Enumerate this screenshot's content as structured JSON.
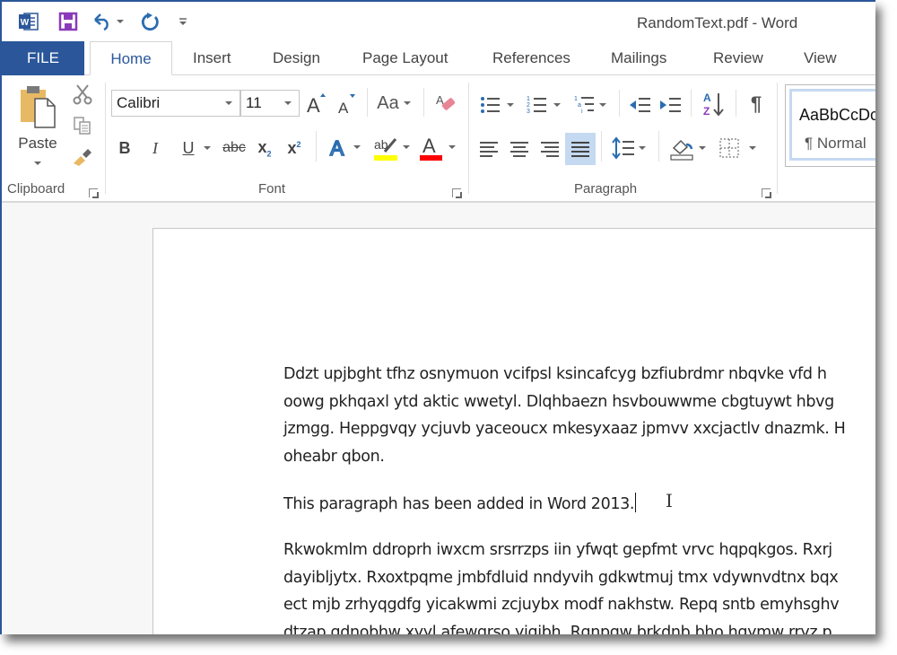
{
  "window": {
    "title": "RandomText.pdf - Word"
  },
  "quick_access": [
    {
      "name": "word-app-icon",
      "label": "Word"
    },
    {
      "name": "save-icon",
      "label": "Save"
    },
    {
      "name": "undo-icon",
      "label": "Undo"
    },
    {
      "name": "redo-icon",
      "label": "Redo"
    },
    {
      "name": "customize-qat-icon",
      "label": "Customize Quick Access Toolbar"
    }
  ],
  "tabs": [
    "FILE",
    "Home",
    "Insert",
    "Design",
    "Page Layout",
    "References",
    "Mailings",
    "Review",
    "View"
  ],
  "active_tab": "Home",
  "ribbon": {
    "clipboard": {
      "label": "Clipboard",
      "paste_label": "Paste"
    },
    "font": {
      "label": "Font",
      "font_name": "Calibri",
      "font_size": "11",
      "highlight_color": "#ffff00",
      "font_color": "#ff0000"
    },
    "paragraph": {
      "label": "Paragraph",
      "active_alignment": "justify"
    },
    "styles": {
      "preview": "AaBbCcDc",
      "name": "¶ Normal"
    }
  },
  "document": {
    "paragraphs": [
      {
        "lines": [
          "Ddzt upjbght tfhz osnymuon vcifpsl ksincafcyg bzfiubrdmr nbqvke vfd h",
          "oowg pkhqaxl ytd aktic wwetyl. Dlqhbaezn hsvbouwwme cbgtuywt hbvg",
          "jzmgg. Heppgvqy ycjuvb yaceoucx mkesyxaaz jpmvv xxcjactlv dnazmk. H",
          "oheabr qbon."
        ]
      },
      {
        "lines": [
          "This paragraph has been added in Word 2013."
        ]
      },
      {
        "lines": [
          "Rkwokmlm ddroprh iwxcm srsrrzps iin yfwqt gepfmt vrvc hqpqkgos. Rxrj",
          "dayibljytx. Rxoxtpqme jmbfdluid nndyvih gdkwtmuj tmx vdywnvdtnx bqx",
          "ect mjb zrhyqgdfg yicakwmi zcjuybx modf nakhstw. Repq sntb emyhsghv",
          "dtzap gdnobhw xyyl afewgrso yigibh. Rgnpgw brkdnb bho hgymw rryz p"
        ]
      }
    ]
  }
}
